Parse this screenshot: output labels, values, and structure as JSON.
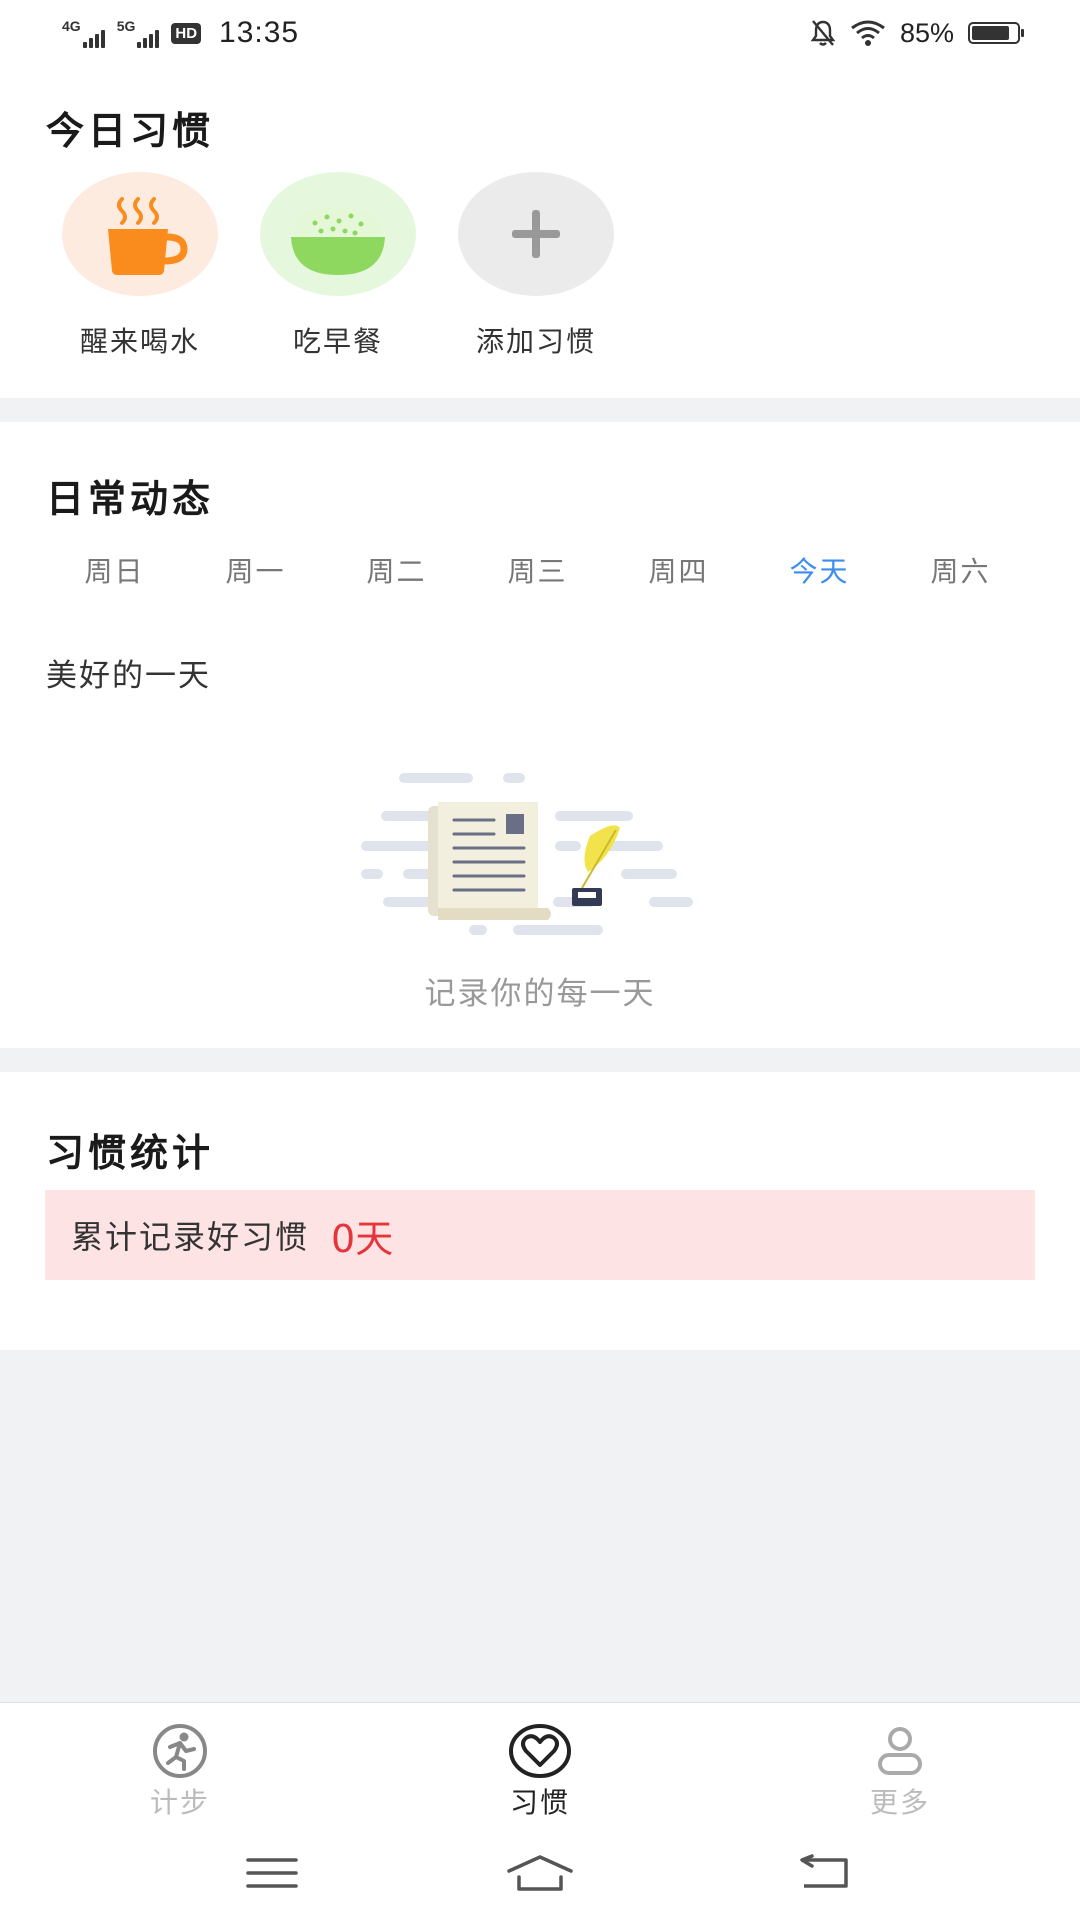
{
  "status_bar": {
    "net1": "4G",
    "net2": "5G",
    "hd": "HD",
    "time": "13:35",
    "battery_percent": "85%",
    "battery_level": 0.85
  },
  "today_habits": {
    "title": "今日习惯",
    "items": [
      {
        "label": "醒来喝水",
        "icon": "coffee-cup-icon",
        "bg": "#fdebe0"
      },
      {
        "label": "吃早餐",
        "icon": "rice-bowl-icon",
        "bg": "#e5f8dd"
      },
      {
        "label": "添加习惯",
        "icon": "plus-icon",
        "bg": "#ebebeb"
      }
    ]
  },
  "daily": {
    "title": "日常动态",
    "tabs": [
      "周日",
      "周一",
      "周二",
      "周三",
      "周四",
      "今天",
      "周六"
    ],
    "active_tab": 5,
    "day_heading": "美好的一天",
    "empty_text": "记录你的每一天"
  },
  "stats": {
    "title": "习惯统计",
    "label": "累计记录好习惯",
    "value": "0天"
  },
  "tab_bar": {
    "items": [
      {
        "label": "计步",
        "icon": "running-person-icon"
      },
      {
        "label": "习惯",
        "icon": "heart-icon"
      },
      {
        "label": "更多",
        "icon": "user-icon"
      }
    ],
    "active": 1
  },
  "colors": {
    "accent_blue": "#3d8cf0",
    "stats_bg": "#fde3e4",
    "stats_value": "#e5343a",
    "cup_orange": "#fa8c1e",
    "bowl_green": "#8ed85f"
  }
}
